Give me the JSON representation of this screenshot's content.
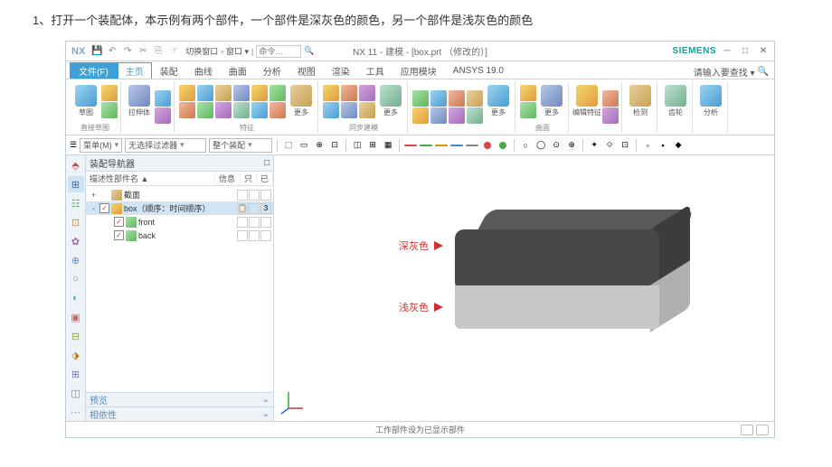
{
  "instruction": "1、打开一个装配体，本示例有两个部件，一个部件是深灰色的颜色，另一个部件是浅灰色的颜色",
  "title_bar": {
    "nx": "NX",
    "switch_win": "切换窗口",
    "window": "窗口",
    "title": "NX 11 - 建模 - [box.prt （修改的）]",
    "siemens": "SIEMENS",
    "search_ph": "命令…",
    "help": "请输入要查找 ▾"
  },
  "tabs": {
    "file": "文件(F)",
    "items": [
      "主页",
      "装配",
      "曲线",
      "曲面",
      "分析",
      "视图",
      "渲染",
      "工具",
      "应用模块",
      "ANSYS 19.0"
    ]
  },
  "ribbon_groups": {
    "g0": "直接草图",
    "g1": "",
    "g2": "特征",
    "g3": "同步建模",
    "g4": "",
    "g5": "曲面",
    "g6": "编辑特征",
    "g7": "检测",
    "g8": "齿轮",
    "g9": "分析"
  },
  "ribbon_btns": {
    "sketch": "草图",
    "stretch": "拉伸体",
    "more1": "更多",
    "more2": "更多",
    "more3": "更多",
    "more4": "更多",
    "more5": "更多"
  },
  "sel_bar": {
    "menu": "菜单(M)",
    "dd1": "无选择过滤器",
    "dd2": "整个装配"
  },
  "nav": {
    "header": "装配导航器",
    "cols": {
      "name": "描述性部件名 ▲",
      "info": "信息",
      "ro": "只",
      "ex": "已"
    },
    "rows": [
      {
        "name": "截面",
        "indent": 0,
        "icon": "c7",
        "toggle": "+"
      },
      {
        "name": "box（顺序：时间顺序）",
        "indent": 0,
        "icon": "c1",
        "toggle": "-",
        "checked": true,
        "sel": true,
        "num": "3"
      },
      {
        "name": "front",
        "indent": 1,
        "icon": "c4",
        "checked": true
      },
      {
        "name": "back",
        "indent": 1,
        "icon": "c4",
        "checked": true
      }
    ],
    "panels": {
      "p1": "预览",
      "p2": "相依性"
    }
  },
  "annotations": {
    "dark": "深灰色",
    "light": "浅灰色"
  },
  "status": {
    "msg": "工作部件设为已显示部件"
  }
}
